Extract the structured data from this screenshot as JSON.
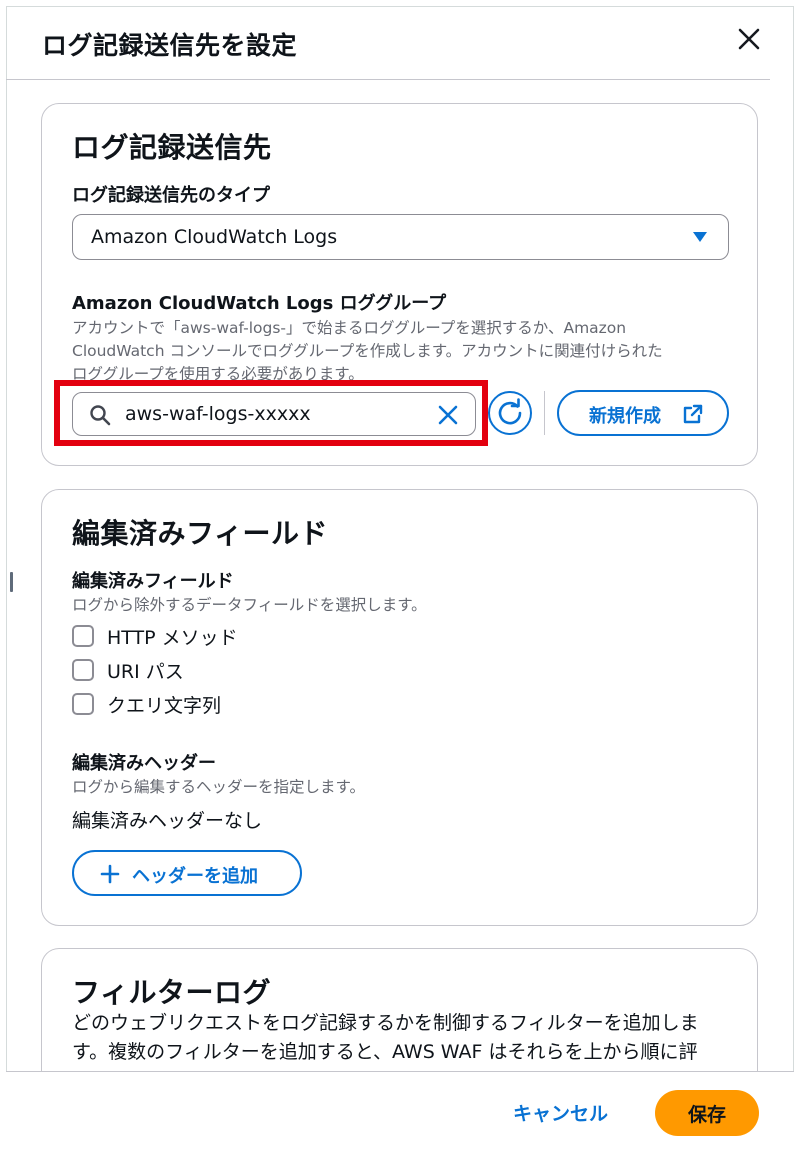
{
  "modal": {
    "title": "ログ記録送信先を設定"
  },
  "destination_card": {
    "title": "ログ記録送信先",
    "type_label": "ログ記録送信先のタイプ",
    "type_value": "Amazon CloudWatch Logs",
    "log_group_label": "Amazon CloudWatch Logs ロググループ",
    "log_group_desc_line1": "アカウントで「aws-waf-logs-」で始まるロググループを選択するか、Amazon",
    "log_group_desc_line2": "CloudWatch コンソールでロググループを作成します。アカウントに関連付けられた",
    "log_group_desc_line3": "ロググループを使用する必要があります。",
    "search_value": "aws-waf-logs-xxxxx",
    "create_new_label": "新規作成"
  },
  "redacted_card": {
    "title": "編集済みフィールド",
    "fields_label": "編集済みフィールド",
    "fields_desc": "ログから除外するデータフィールドを選択します。",
    "checkboxes": [
      {
        "label": "HTTP メソッド",
        "checked": false
      },
      {
        "label": "URI パス",
        "checked": false
      },
      {
        "label": "クエリ文字列",
        "checked": false
      }
    ],
    "headers_label": "編集済みヘッダー",
    "headers_desc": "ログから編集するヘッダーを指定します。",
    "headers_empty": "編集済みヘッダーなし",
    "add_header_label": "ヘッダーを追加"
  },
  "filter_card": {
    "title": "フィルターログ",
    "desc_line1": "どのウェブリクエストをログ記録するかを制御するフィルターを追加しま",
    "desc_line2": "す。複数のフィルターを追加すると、AWS WAF はそれらを上から順に評"
  },
  "footer": {
    "cancel_label": "キャンセル",
    "save_label": "保存"
  },
  "colors": {
    "primary": "#0972d3",
    "accent": "#ff9900",
    "highlight": "#e3000f",
    "border": "#c6c6cd"
  }
}
